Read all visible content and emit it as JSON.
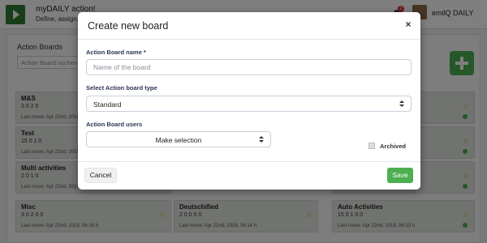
{
  "app": {
    "title": "myDAILY action!",
    "subtitle": "Define, assign, c",
    "notification_count": "2",
    "user_name": "emilQ DAILY"
  },
  "boards_panel": {
    "title": "Action Boards",
    "search_placeholder": "Action Board suchen"
  },
  "boards": [
    {
      "name": "M&S",
      "stats": "3  0  2  0",
      "last_move": "Last move: Apr 22nd, 2018, 06:19 h"
    },
    {
      "name": "Test",
      "stats": "15  0  1  0",
      "last_move": "Last move: Apr 22nd, 2018, 06:18 h"
    },
    {
      "name": "Multi activities",
      "stats": "2  0  1  0",
      "last_move": "Last move: Apr 22nd, 2018, 06:17 h"
    },
    {
      "name": "Misc",
      "stats": "3  0  2  0  0",
      "last_move": "Last move: Apr 22nd, 2018, 06:16 h"
    },
    {
      "name": "Deutschified",
      "stats": "2  0  0  0  0",
      "last_move": "Last move: Apr 22nd, 2018, 06:14 h"
    },
    {
      "name": "Auto Activities",
      "stats": "15  0  1  0  0",
      "last_move": "Last move: Apr 22nd, 2018, 06:13 h"
    }
  ],
  "modal": {
    "title": "Create new board",
    "close_icon": "×",
    "name_label": "Action Board name *",
    "name_placeholder": "Name of the board",
    "type_label": "Select Action board type",
    "type_value": "Standard",
    "users_label": "Action Board users",
    "users_value": "Make selection",
    "archived_label": "Archived",
    "cancel_label": "Cancel",
    "save_label": "Save"
  },
  "colors": {
    "accent_green": "#4caf50",
    "dark_green": "#2e7d32",
    "label_navy": "#2a3550"
  }
}
